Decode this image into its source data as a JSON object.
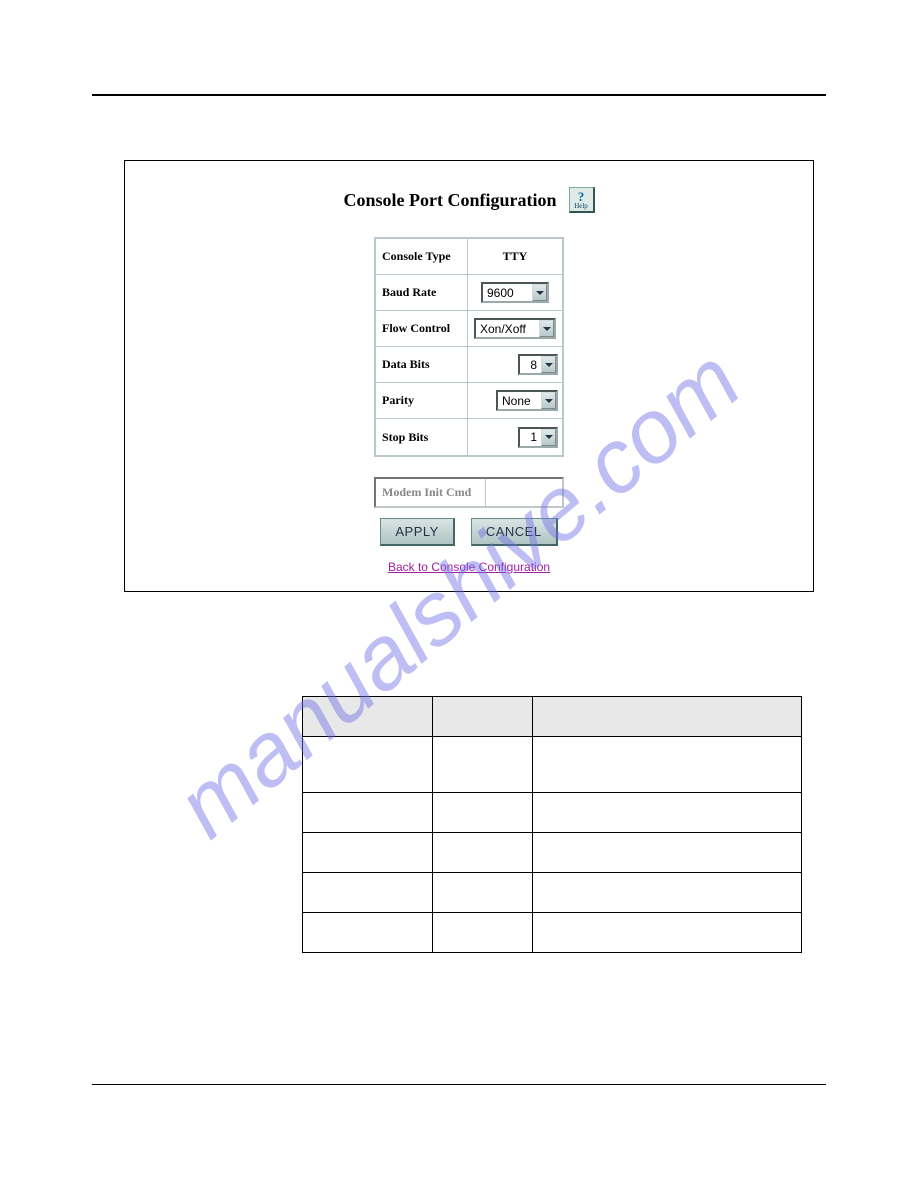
{
  "watermark": "manualshive.com",
  "figure": {
    "title": "Console Port Configuration",
    "help_label": "Help",
    "rows": [
      {
        "label": "Console Type",
        "value": "TTY",
        "is_select": false
      },
      {
        "label": "Baud Rate",
        "value": "9600",
        "is_select": true
      },
      {
        "label": "Flow Control",
        "value": "Xon/Xoff",
        "is_select": true
      },
      {
        "label": "Data Bits",
        "value": "8",
        "is_select": true
      },
      {
        "label": "Parity",
        "value": "None",
        "is_select": true
      },
      {
        "label": "Stop Bits",
        "value": "1",
        "is_select": true
      }
    ],
    "modem_label": "Modem Init Cmd",
    "buttons": {
      "apply": "APPLY",
      "cancel": "CANCEL"
    },
    "back_link": "Back to Console Configuration"
  },
  "param_table": {
    "headers": [
      "",
      "",
      ""
    ],
    "rows": [
      [
        "",
        "",
        ""
      ],
      [
        "",
        "",
        ""
      ],
      [
        "",
        "",
        ""
      ],
      [
        "",
        "",
        ""
      ],
      [
        "",
        "",
        ""
      ]
    ]
  }
}
